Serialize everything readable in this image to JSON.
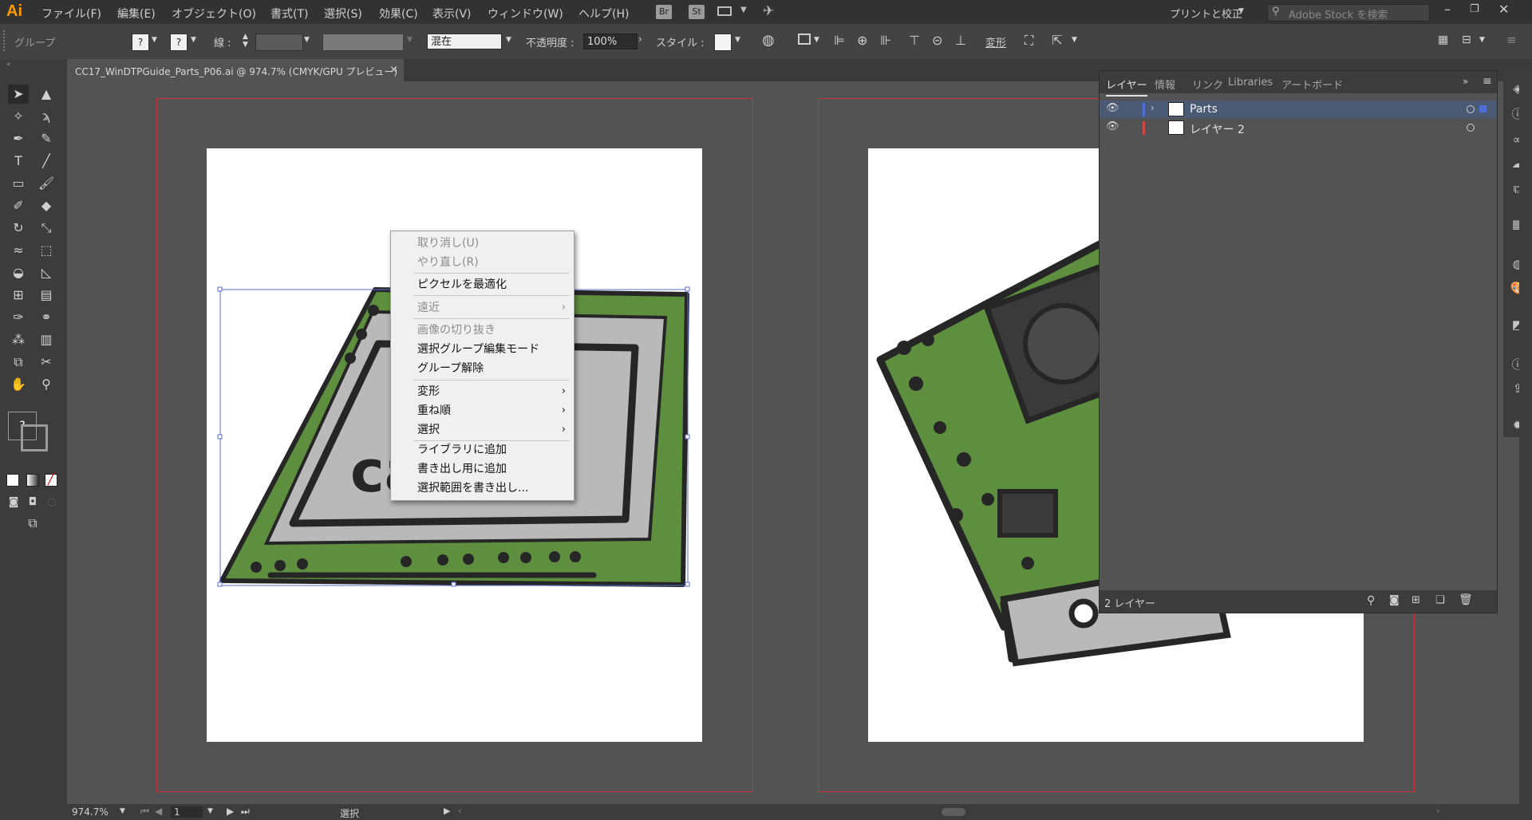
{
  "app": {
    "logo": "Ai"
  },
  "menu": [
    "ファイル(F)",
    "編集(E)",
    "オブジェクト(O)",
    "書式(T)",
    "選択(S)",
    "効果(C)",
    "表示(V)",
    "ウィンドウ(W)",
    "ヘルプ(H)"
  ],
  "menubar_icons": {
    "bridge": "Br",
    "stock": "St"
  },
  "workspace": {
    "label": "プリントと校正"
  },
  "search": {
    "placeholder": "Adobe Stock を検索"
  },
  "control": {
    "selection_type": "グループ",
    "fill_label": "?",
    "stroke_label": "?",
    "stroke_weight_label": "線 :",
    "blend_mode": "混在",
    "opacity_label": "不透明度 :",
    "opacity_value": "100%",
    "style_label": "スタイル :",
    "transform_label": "変形"
  },
  "document": {
    "tab_title": "CC17_WinDTPGuide_Parts_P06.ai @ 974.7% (CMYK/GPU プレビュー)",
    "close": "×"
  },
  "context_menu": {
    "items": [
      {
        "label": "取り消し(U)",
        "disabled": true
      },
      {
        "label": "やり直し(R)",
        "disabled": true
      },
      {
        "label": "ピクセルを最適化",
        "disabled": false
      },
      {
        "label": "遠近",
        "disabled": true,
        "submenu": true
      },
      {
        "label": "画像の切り抜き",
        "disabled": true
      },
      {
        "label": "選択グループ編集モード",
        "disabled": false
      },
      {
        "label": "グループ解除",
        "disabled": false
      },
      {
        "label": "変形",
        "disabled": false,
        "submenu": true
      },
      {
        "label": "重ね順",
        "disabled": false,
        "submenu": true
      },
      {
        "label": "選択",
        "disabled": false,
        "submenu": true
      },
      {
        "label": "ライブラリに追加",
        "disabled": false
      },
      {
        "label": "書き出し用に追加",
        "disabled": false
      },
      {
        "label": "選択範囲を書き出し...",
        "disabled": false
      }
    ]
  },
  "layers_panel": {
    "tabs": [
      "レイヤー",
      "情報",
      "リンク",
      "Libraries",
      "アートボード"
    ],
    "active_tab": "レイヤー",
    "layers": [
      {
        "name": "Parts",
        "color": "#4f6fd6",
        "selected": true
      },
      {
        "name": "レイヤー 2",
        "color": "#d04848",
        "selected": false
      }
    ],
    "footer": "2 レイヤー"
  },
  "status": {
    "zoom": "974.7%",
    "artboard": "1",
    "tool": "選択"
  },
  "colors": {
    "board_green": "#5e8f3e",
    "board_gray": "#b9b9b9",
    "outline": "#262626",
    "selection": "#5a6fd0",
    "bleed": "#c8323c"
  },
  "artwork_text": "canon"
}
